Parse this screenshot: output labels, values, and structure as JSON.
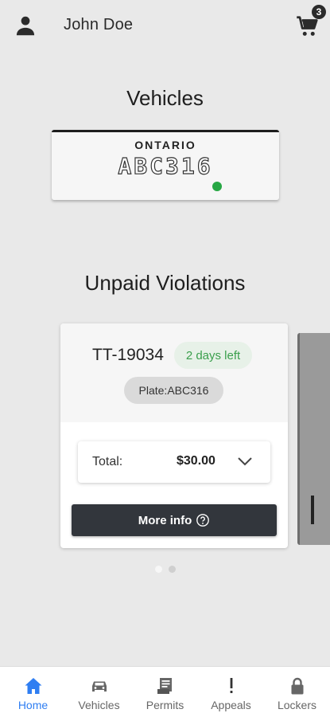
{
  "header": {
    "user_name": "John Doe",
    "cart_count": "3"
  },
  "vehicles": {
    "title": "Vehicles",
    "plate": {
      "province": "ONTARIO",
      "number": "ABC316",
      "status_color": "#27a744"
    }
  },
  "violations": {
    "title": "Unpaid Violations",
    "card": {
      "ticket_id": "TT-19034",
      "days_left": "2 days left",
      "plate_chip": "Plate:ABC316",
      "total_label": "Total:",
      "total_amount": "$30.00",
      "more_info_label": "More info"
    },
    "carousel": {
      "count": 2,
      "active_index": 0
    }
  },
  "nav": {
    "active_color": "#2f7ef2",
    "items": [
      {
        "label": "Home",
        "icon": "home-icon"
      },
      {
        "label": "Vehicles",
        "icon": "car-icon"
      },
      {
        "label": "Permits",
        "icon": "permit-icon"
      },
      {
        "label": "Appeals",
        "icon": "exclamation-icon"
      },
      {
        "label": "Lockers",
        "icon": "lock-icon"
      }
    ]
  }
}
